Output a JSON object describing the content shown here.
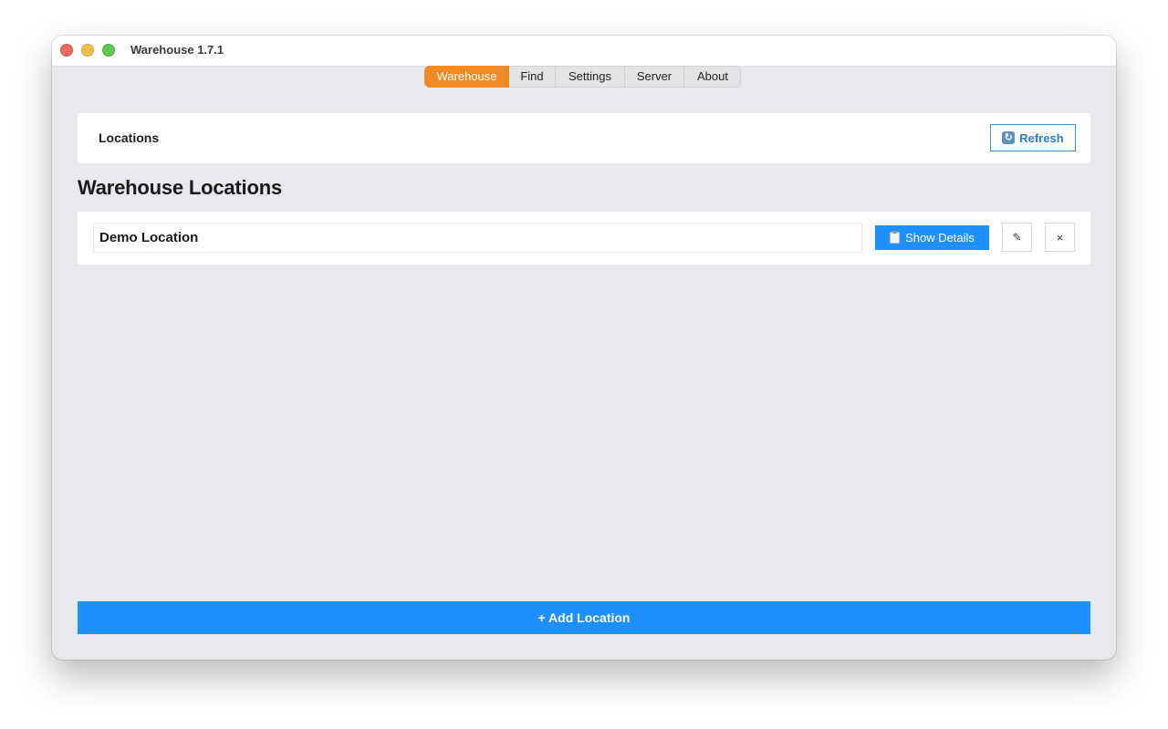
{
  "window": {
    "title": "Warehouse 1.7.1"
  },
  "tabs": [
    {
      "label": "Warehouse",
      "active": true
    },
    {
      "label": "Find",
      "active": false
    },
    {
      "label": "Settings",
      "active": false
    },
    {
      "label": "Server",
      "active": false
    },
    {
      "label": "About",
      "active": false
    }
  ],
  "header": {
    "title": "Locations",
    "refresh_label": "Refresh",
    "refresh_icon": "refresh-icon"
  },
  "page": {
    "title": "Warehouse Locations"
  },
  "locations": [
    {
      "name": "Demo Location",
      "show_details_label": "Show Details",
      "details_icon": "clipboard-icon",
      "edit_icon": "✎",
      "delete_icon": "×"
    }
  ],
  "footer": {
    "add_label": "+ Add Location"
  },
  "colors": {
    "accent_tab": "#f08a24",
    "primary_button": "#1e90ff",
    "window_background": "#e8e9ec"
  }
}
